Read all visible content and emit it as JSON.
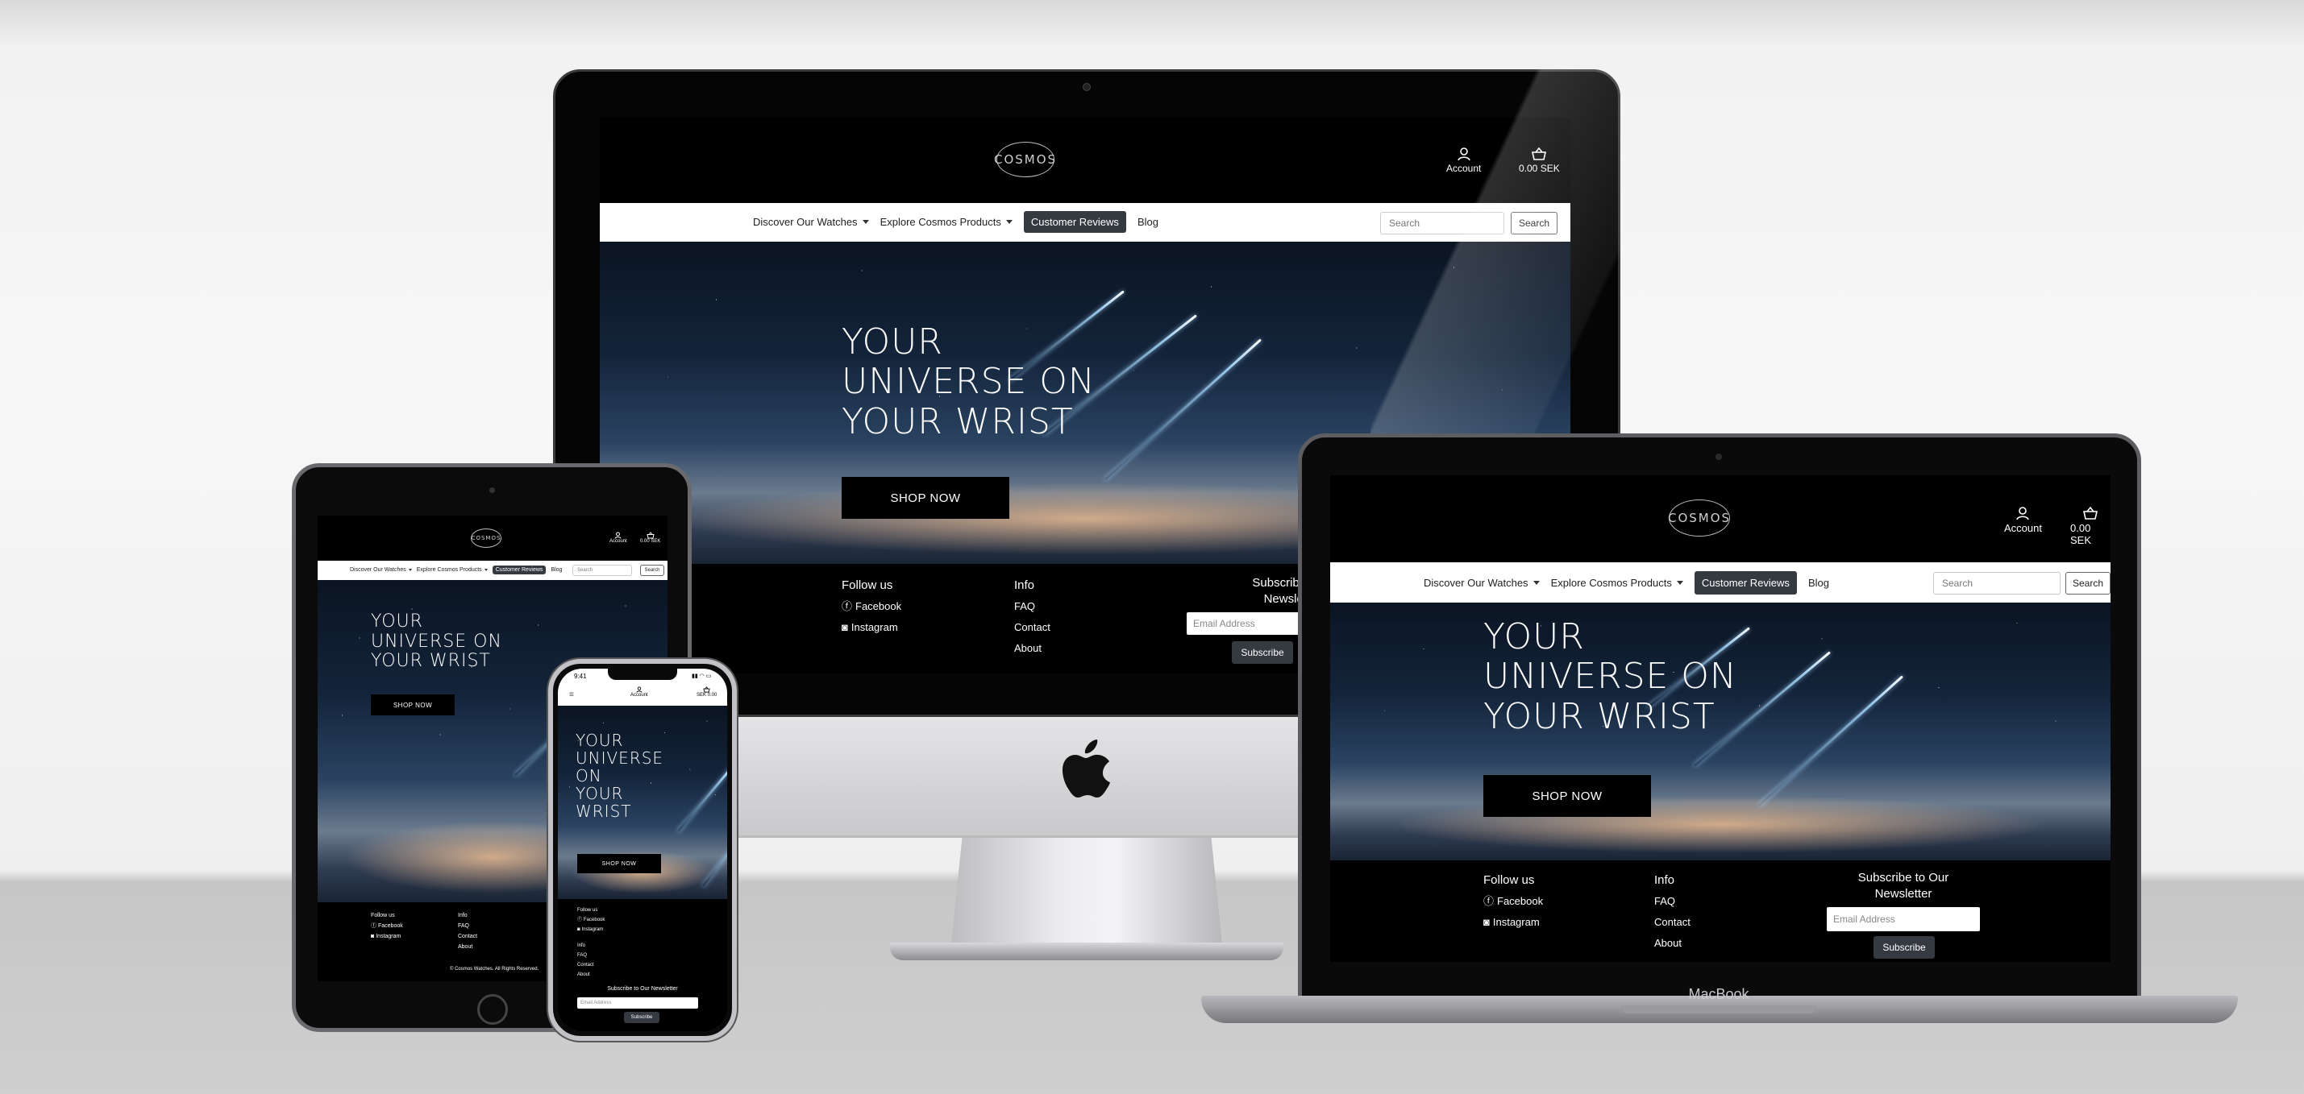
{
  "site": {
    "logo_text": "COSMOS",
    "account_label": "Account",
    "cart_total": "0.00 SEK",
    "cart_total_mobile": "SEK 0.00",
    "nav": {
      "watches": "Discover Our Watches",
      "products": "Explore Cosmos Products",
      "reviews": "Customer Reviews",
      "blog": "Blog"
    },
    "search_placeholder": "Search",
    "search_button": "Search",
    "hero_title": "YOUR UNIVERSE ON YOUR WRIST",
    "hero_line1": "YOUR",
    "hero_line2": "UNIVERSE ON",
    "hero_line3": "YOUR WRIST",
    "hero_mobile_line1": "YOUR",
    "hero_mobile_line2": "UNIVERSE",
    "hero_mobile_line3": "ON",
    "hero_mobile_line4": "YOUR",
    "hero_mobile_line5": "WRIST",
    "shop_button": "SHOP NOW",
    "footer": {
      "follow_heading": "Follow us",
      "facebook": "Facebook",
      "instagram": "Instagram",
      "info_heading": "Info",
      "faq": "FAQ",
      "contact": "Contact",
      "about": "About",
      "newsletter_heading": "Subscribe to Our Newsletter",
      "newsletter_line1": "Subscribe to Our",
      "newsletter_line2": "Newsletter",
      "newsletter_clipped": "Subscribe to O",
      "email_placeholder": "Email Address",
      "subscribe_button": "Subscribe",
      "copyright": "© Cosmos Watches. All Rights Reserved."
    }
  },
  "phone_status": {
    "time": "9:41"
  },
  "devices": {
    "laptop_label": "MacBook"
  },
  "colors": {
    "black": "#000000",
    "active_nav": "#343a40",
    "white": "#ffffff"
  }
}
